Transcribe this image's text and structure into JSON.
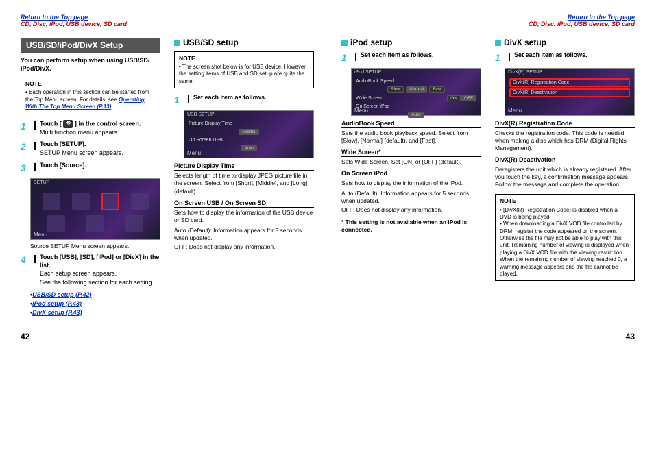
{
  "header": {
    "return_link": "Return to the Top page",
    "breadcrumb": "CD, Disc, iPod, USB device, SD card"
  },
  "page_left": {
    "col1": {
      "title_bar": "USB/SD/iPod/DivX Setup",
      "intro": "You can perform setup when using USB/SD/ iPod/DivX.",
      "note_title": "NOTE",
      "note_item": "Each operation in this section can be started from the Top Menu screen. For details, see ",
      "note_link": "Operating With The Top Menu Screen (P.13)",
      "note_period": ".",
      "step1_head_a": "Touch [ ",
      "step1_head_b": " ] in the control screen.",
      "step1_icon": "⟲",
      "step1_sub": "Multi function menu appears.",
      "step2_head": "Touch [SETUP].",
      "step2_sub": "SETUP Menu screen appears.",
      "step3_head": "Touch [Source].",
      "shot1_title": "SETUP",
      "shot_menu": "Menu",
      "shot1_caption": "Source SETUP Menu screen appears.",
      "step4_head": "Touch [USB], [SD], [iPod] or [DivX] in the list.",
      "step4_sub1": "Each setup screen appears.",
      "step4_sub2": "See the following section for each setting.",
      "xref1": "USB/SD setup (P.42)",
      "xref2": "iPod setup (P.43)",
      "xref3": "DivX setup (P.43)"
    },
    "col2": {
      "heading": "USB/SD setup",
      "note_title": "NOTE",
      "note_item": "The screen shot below is for USB device. However, the setting items of USB and SD setup are quite the same.",
      "step1_head": "Set each item as follows.",
      "shot_title": "USB SETUP",
      "shot_row1": "Picture Display Time",
      "shot_row1_val": "Middle",
      "shot_row2": "On Screen USB",
      "shot_row2_val": "Auto",
      "shot_menu": "Menu",
      "sub1": "Picture Display Time",
      "sub1_desc": "Selects length of time to display JPEG picture file in the screen. Select from [Short], [Middle], and [Long] (default).",
      "sub2": "On Screen USB / On Screen SD",
      "sub2_desc": "Sets how to display the information of the USB device or SD card.",
      "auto_lbl": "Auto (Default): ",
      "auto_txt": "Information appears for 5 seconds when updated.",
      "off_lbl": "OFF: ",
      "off_txt": "Does not display any information."
    },
    "num": "42"
  },
  "page_right": {
    "col1": {
      "heading": "iPod setup",
      "step1_head": "Set each item as follows.",
      "shot_title": "iPod SETUP",
      "shot_r1": "AudioBook Speed",
      "shot_r1_b1": "Slow",
      "shot_r1_b2": "Normal",
      "shot_r1_b3": "Fast",
      "shot_r2": "Wide Screen",
      "shot_r2_b1": "ON",
      "shot_r2_b2": "OFF",
      "shot_r3": "On Screen iPod",
      "shot_r3_val": "Auto",
      "shot_menu": "Menu",
      "sub1": "AudioBook Speed",
      "sub1_desc": "Sets the audio book playback speed. Select from [Slow], [Normal] (default), and [Fast].",
      "sub2": "Wide Screen*",
      "sub2_desc": "Sets Wide Screen. Set [ON] or [OFF] (default).",
      "sub3": "On Screen iPod",
      "sub3_desc": "Sets how to display the information of the iPod.",
      "auto_lbl": "Auto (Default): ",
      "auto_txt": "Information appears for 5 seconds when updated.",
      "off_lbl": "OFF: ",
      "off_txt": "Does not display any information.",
      "asterisk": "* This setting is not available when an iPod is connected."
    },
    "col2": {
      "heading": "DivX setup",
      "step1_head": "Set each item as follows.",
      "shot_title": "DivX(R) SETUP",
      "shot_r1": "DivX(R) Registration Code",
      "shot_r2": "DivX(R) Deactivation",
      "shot_menu": "Menu",
      "sub1": "DivX(R) Registration Code",
      "sub1_desc": "Checks the registration code. This code is needed when making a disc which has DRM (Digital Rights Management).",
      "sub2": "DivX(R) Deactivation",
      "sub2_desc": "Deregisters the unit which is already registered. After you touch the key, a confirmation message appears. Follow the message and complete the operation.",
      "note_title": "NOTE",
      "note1": "[DivX(R) Registration Code] is disabled when a DVD is being played.",
      "note2": "When downloading a DivX VOD file controlled by DRM, register the code appeared on the screen. Otherwise the file may not be able to play with this unit. Remaining number of viewing is displayed when playing a DivX VOD file with the viewing restriction. When the remaining number of viewing reached 0, a warning message appears and the file cannot be played."
    },
    "num": "43"
  }
}
